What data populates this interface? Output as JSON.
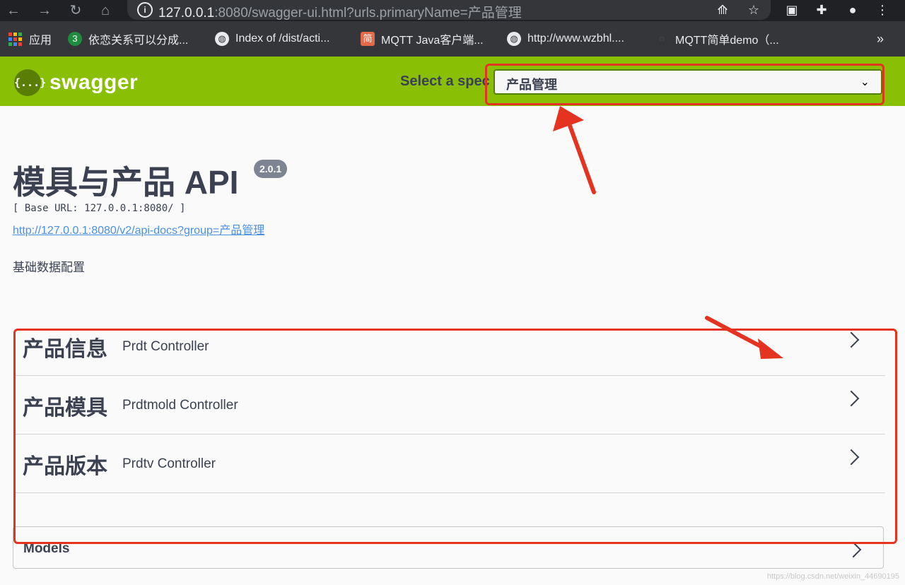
{
  "browser": {
    "url_host": "127.0.0.1",
    "url_rest": ":8080/swagger-ui.html?urls.primaryName=产品管理",
    "bookmarks": [
      {
        "label": "应用",
        "icon": "apps-grid-icon"
      },
      {
        "label": "依恋关系可以分成...",
        "icon": "badge-3-icon",
        "icon_text": "3",
        "color": "#1e8e3e"
      },
      {
        "label": "Index of /dist/acti...",
        "icon": "globe-icon"
      },
      {
        "label": "MQTT Java客户端...",
        "icon": "jian-icon",
        "icon_text": "简",
        "color": "#e26a4a"
      },
      {
        "label": "http://www.wzbhl....",
        "icon": "globe-icon"
      },
      {
        "label": "MQTT简单demo（...",
        "icon": "page-icon"
      }
    ],
    "more": "»"
  },
  "topbar": {
    "logo_glyph": "{...}",
    "logo_text": "swagger",
    "spec_label": "Select a spec",
    "spec_selected": "产品管理"
  },
  "info": {
    "title": "模具与产品 API",
    "version": "2.0.1",
    "base_url": "[ Base URL: 127.0.0.1:8080/ ]",
    "api_docs_link": "http://127.0.0.1:8080/v2/api-docs?group=产品管理",
    "description": "基础数据配置"
  },
  "tags": [
    {
      "name": "产品信息",
      "desc": "Prdt Controller"
    },
    {
      "name": "产品模具",
      "desc": "Prdtmold Controller"
    },
    {
      "name": "产品版本",
      "desc": "Prdtv Controller"
    }
  ],
  "models": {
    "title": "Models"
  },
  "watermark": "https://blog.csdn.net/weixin_44690195",
  "colors": {
    "swagger_green": "#89bf04",
    "annotation_red": "#e53322",
    "link_blue": "#4990e2"
  }
}
